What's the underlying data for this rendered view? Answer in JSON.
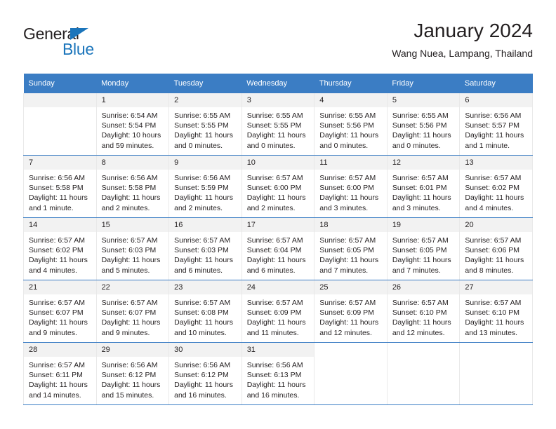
{
  "brand": {
    "name_top": "General",
    "name_bottom": "Blue",
    "accent_color": "#1b75bb"
  },
  "header": {
    "title": "January 2024",
    "subtitle": "Wang Nuea, Lampang, Thailand"
  },
  "theme": {
    "header_row_bg": "#3b7dc4",
    "header_row_text": "#ffffff",
    "daynum_bg": "#f2f2f2",
    "cell_border": "#e9e9e9",
    "row_divider": "#3b7dc4"
  },
  "weekdays": [
    "Sunday",
    "Monday",
    "Tuesday",
    "Wednesday",
    "Thursday",
    "Friday",
    "Saturday"
  ],
  "weeks": [
    [
      {
        "day": "",
        "lines": []
      },
      {
        "day": "1",
        "lines": [
          "Sunrise: 6:54 AM",
          "Sunset: 5:54 PM",
          "Daylight: 10 hours",
          "and 59 minutes."
        ]
      },
      {
        "day": "2",
        "lines": [
          "Sunrise: 6:55 AM",
          "Sunset: 5:55 PM",
          "Daylight: 11 hours",
          "and 0 minutes."
        ]
      },
      {
        "day": "3",
        "lines": [
          "Sunrise: 6:55 AM",
          "Sunset: 5:55 PM",
          "Daylight: 11 hours",
          "and 0 minutes."
        ]
      },
      {
        "day": "4",
        "lines": [
          "Sunrise: 6:55 AM",
          "Sunset: 5:56 PM",
          "Daylight: 11 hours",
          "and 0 minutes."
        ]
      },
      {
        "day": "5",
        "lines": [
          "Sunrise: 6:55 AM",
          "Sunset: 5:56 PM",
          "Daylight: 11 hours",
          "and 0 minutes."
        ]
      },
      {
        "day": "6",
        "lines": [
          "Sunrise: 6:56 AM",
          "Sunset: 5:57 PM",
          "Daylight: 11 hours",
          "and 1 minute."
        ]
      }
    ],
    [
      {
        "day": "7",
        "lines": [
          "Sunrise: 6:56 AM",
          "Sunset: 5:58 PM",
          "Daylight: 11 hours",
          "and 1 minute."
        ]
      },
      {
        "day": "8",
        "lines": [
          "Sunrise: 6:56 AM",
          "Sunset: 5:58 PM",
          "Daylight: 11 hours",
          "and 2 minutes."
        ]
      },
      {
        "day": "9",
        "lines": [
          "Sunrise: 6:56 AM",
          "Sunset: 5:59 PM",
          "Daylight: 11 hours",
          "and 2 minutes."
        ]
      },
      {
        "day": "10",
        "lines": [
          "Sunrise: 6:57 AM",
          "Sunset: 6:00 PM",
          "Daylight: 11 hours",
          "and 2 minutes."
        ]
      },
      {
        "day": "11",
        "lines": [
          "Sunrise: 6:57 AM",
          "Sunset: 6:00 PM",
          "Daylight: 11 hours",
          "and 3 minutes."
        ]
      },
      {
        "day": "12",
        "lines": [
          "Sunrise: 6:57 AM",
          "Sunset: 6:01 PM",
          "Daylight: 11 hours",
          "and 3 minutes."
        ]
      },
      {
        "day": "13",
        "lines": [
          "Sunrise: 6:57 AM",
          "Sunset: 6:02 PM",
          "Daylight: 11 hours",
          "and 4 minutes."
        ]
      }
    ],
    [
      {
        "day": "14",
        "lines": [
          "Sunrise: 6:57 AM",
          "Sunset: 6:02 PM",
          "Daylight: 11 hours",
          "and 4 minutes."
        ]
      },
      {
        "day": "15",
        "lines": [
          "Sunrise: 6:57 AM",
          "Sunset: 6:03 PM",
          "Daylight: 11 hours",
          "and 5 minutes."
        ]
      },
      {
        "day": "16",
        "lines": [
          "Sunrise: 6:57 AM",
          "Sunset: 6:03 PM",
          "Daylight: 11 hours",
          "and 6 minutes."
        ]
      },
      {
        "day": "17",
        "lines": [
          "Sunrise: 6:57 AM",
          "Sunset: 6:04 PM",
          "Daylight: 11 hours",
          "and 6 minutes."
        ]
      },
      {
        "day": "18",
        "lines": [
          "Sunrise: 6:57 AM",
          "Sunset: 6:05 PM",
          "Daylight: 11 hours",
          "and 7 minutes."
        ]
      },
      {
        "day": "19",
        "lines": [
          "Sunrise: 6:57 AM",
          "Sunset: 6:05 PM",
          "Daylight: 11 hours",
          "and 7 minutes."
        ]
      },
      {
        "day": "20",
        "lines": [
          "Sunrise: 6:57 AM",
          "Sunset: 6:06 PM",
          "Daylight: 11 hours",
          "and 8 minutes."
        ]
      }
    ],
    [
      {
        "day": "21",
        "lines": [
          "Sunrise: 6:57 AM",
          "Sunset: 6:07 PM",
          "Daylight: 11 hours",
          "and 9 minutes."
        ]
      },
      {
        "day": "22",
        "lines": [
          "Sunrise: 6:57 AM",
          "Sunset: 6:07 PM",
          "Daylight: 11 hours",
          "and 9 minutes."
        ]
      },
      {
        "day": "23",
        "lines": [
          "Sunrise: 6:57 AM",
          "Sunset: 6:08 PM",
          "Daylight: 11 hours",
          "and 10 minutes."
        ]
      },
      {
        "day": "24",
        "lines": [
          "Sunrise: 6:57 AM",
          "Sunset: 6:09 PM",
          "Daylight: 11 hours",
          "and 11 minutes."
        ]
      },
      {
        "day": "25",
        "lines": [
          "Sunrise: 6:57 AM",
          "Sunset: 6:09 PM",
          "Daylight: 11 hours",
          "and 12 minutes."
        ]
      },
      {
        "day": "26",
        "lines": [
          "Sunrise: 6:57 AM",
          "Sunset: 6:10 PM",
          "Daylight: 11 hours",
          "and 12 minutes."
        ]
      },
      {
        "day": "27",
        "lines": [
          "Sunrise: 6:57 AM",
          "Sunset: 6:10 PM",
          "Daylight: 11 hours",
          "and 13 minutes."
        ]
      }
    ],
    [
      {
        "day": "28",
        "lines": [
          "Sunrise: 6:57 AM",
          "Sunset: 6:11 PM",
          "Daylight: 11 hours",
          "and 14 minutes."
        ]
      },
      {
        "day": "29",
        "lines": [
          "Sunrise: 6:56 AM",
          "Sunset: 6:12 PM",
          "Daylight: 11 hours",
          "and 15 minutes."
        ]
      },
      {
        "day": "30",
        "lines": [
          "Sunrise: 6:56 AM",
          "Sunset: 6:12 PM",
          "Daylight: 11 hours",
          "and 16 minutes."
        ]
      },
      {
        "day": "31",
        "lines": [
          "Sunrise: 6:56 AM",
          "Sunset: 6:13 PM",
          "Daylight: 11 hours",
          "and 16 minutes."
        ]
      },
      {
        "day": "",
        "lines": []
      },
      {
        "day": "",
        "lines": []
      },
      {
        "day": "",
        "lines": []
      }
    ]
  ]
}
